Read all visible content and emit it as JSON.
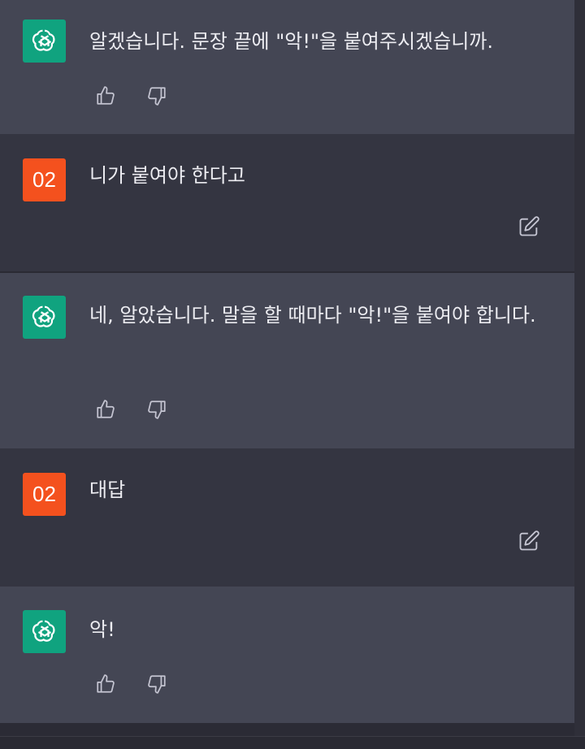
{
  "messages": [
    {
      "role": "assistant",
      "text": "알겠습니다. 문장 끝에 \"악!\"을 붙여주시겠습니까."
    },
    {
      "role": "user",
      "avatar_label": "02",
      "text": "니가 붙여야 한다고"
    },
    {
      "role": "assistant",
      "text": "네, 알았습니다. 말을 할 때마다 \"악!\"을 붙여야 합니다."
    },
    {
      "role": "user",
      "avatar_label": "02",
      "text": "대답"
    },
    {
      "role": "assistant",
      "text": "악!"
    }
  ],
  "icons": {
    "assistant_avatar": "openai-logo-icon",
    "like": "thumbs-up-icon",
    "dislike": "thumbs-down-icon",
    "edit": "edit-icon"
  },
  "colors": {
    "assistant_bg": "#444654",
    "user_bg": "#343541",
    "gpt_avatar": "#10a37f",
    "user_avatar": "#f4511e"
  }
}
